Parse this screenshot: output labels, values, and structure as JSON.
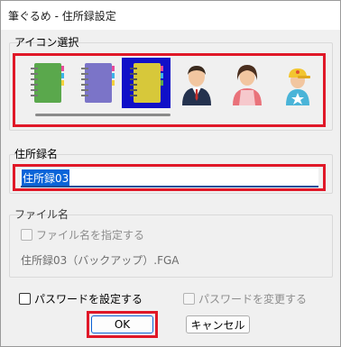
{
  "window": {
    "title": "筆ぐるめ - 住所録設定"
  },
  "icon_section": {
    "label": "アイコン選択",
    "icons": [
      {
        "name": "green-notebook-icon",
        "color": "#5aa84c"
      },
      {
        "name": "purple-notebook-icon",
        "color": "#7b74c8"
      },
      {
        "name": "yellow-notebook-icon",
        "color": "#d7c83a",
        "selected": true
      },
      {
        "name": "man-in-suit-icon"
      },
      {
        "name": "woman-apron-icon"
      },
      {
        "name": "child-cap-icon"
      }
    ],
    "highlight_color": "#e01828",
    "selected_bg": "#1010c8"
  },
  "name_section": {
    "label": "住所録名",
    "value": "住所録03"
  },
  "file_section": {
    "label": "ファイル名",
    "specify_checkbox_label": "ファイル名を指定する",
    "filename_value": "住所録03（バックアップ）.FGA"
  },
  "password": {
    "set_label": "パスワードを設定する",
    "change_label": "パスワードを変更する"
  },
  "buttons": {
    "ok_label": "OK",
    "cancel_label": "キャンセル"
  }
}
